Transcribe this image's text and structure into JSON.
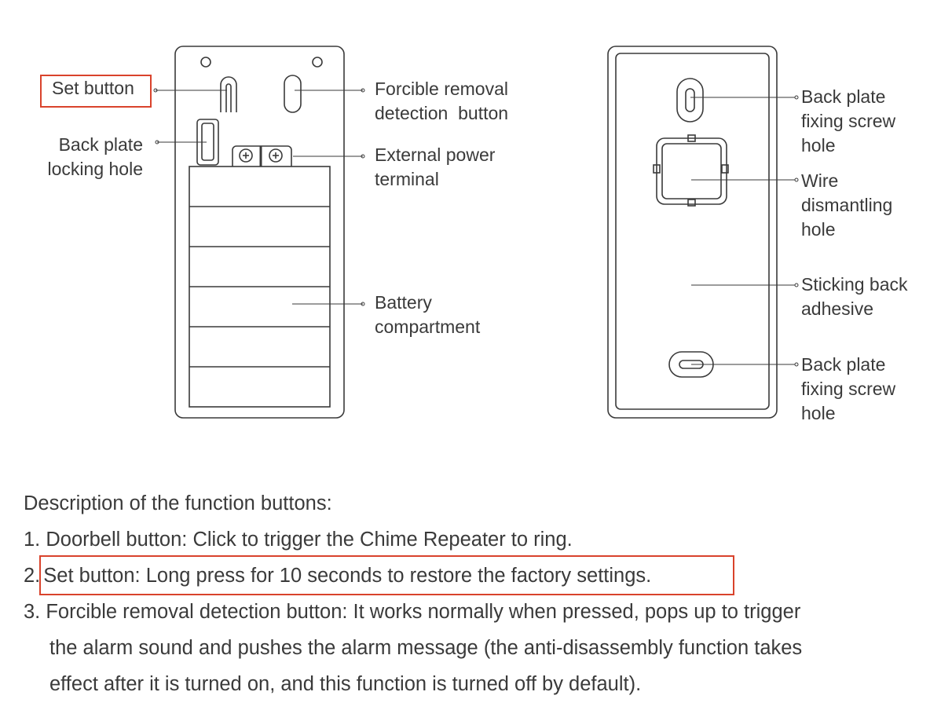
{
  "labels": {
    "set_button": "Set button",
    "forcible_removal": [
      "Forcible removal",
      "detection  button"
    ],
    "back_plate_locking_hole": [
      "Back plate",
      "locking hole"
    ],
    "external_power_terminal": [
      "External power",
      "terminal"
    ],
    "battery_compartment": [
      "Battery",
      "compartment"
    ],
    "back_plate_fixing_screw_hole_top": [
      "Back plate",
      "fixing screw",
      "hole"
    ],
    "wire_dismantling_hole": [
      "Wire",
      "dismantling",
      "hole"
    ],
    "sticking_back_adhesive": [
      "Sticking back",
      "adhesive"
    ],
    "back_plate_fixing_screw_hole_bottom": [
      "Back plate",
      "fixing screw",
      "hole"
    ]
  },
  "description": {
    "heading": "Description of the function buttons:",
    "item1": "1. Doorbell button: Click to trigger the Chime Repeater to ring.",
    "item2_num": "2.",
    "item2_text": "Set button: Long press for 10 seconds to restore the factory settings.",
    "item3_line1": "3. Forcible removal detection button: It works normally when pressed, pops up to trigger",
    "item3_line2": "the alarm sound and pushes the alarm message (the anti-disassembly function takes",
    "item3_line3": "effect after it is turned on, and this function is turned off by default)."
  },
  "colors": {
    "highlight": "#d9432c",
    "line": "#3a3a3a"
  }
}
